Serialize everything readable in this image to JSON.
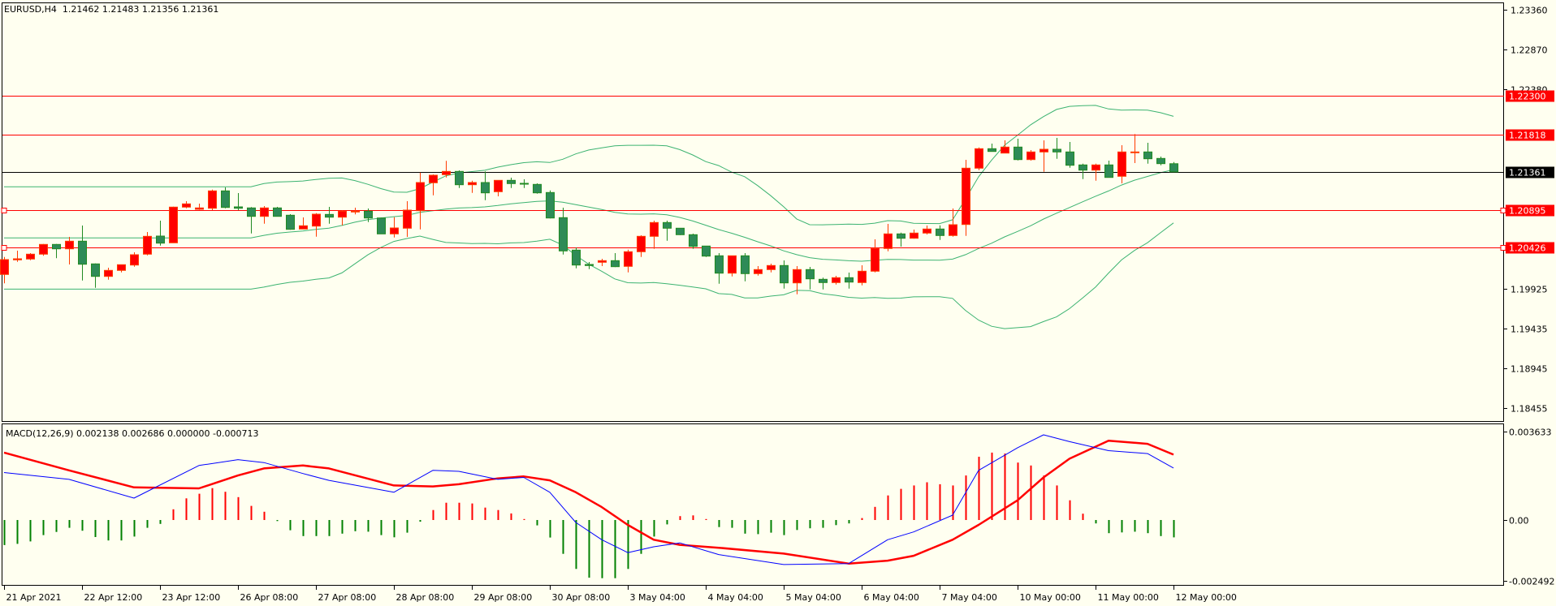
{
  "header": {
    "symbol_tf": "EURUSD,H4",
    "ohlc": "1.21462 1.21483 1.21356 1.21361"
  },
  "macd_header": "MACD(12,26,9) 0.002138 0.002686 0.000000 -0.000713",
  "colors": {
    "background": "#fffff0",
    "bull_body": "#ff0000",
    "bull_border": "#ff3c00",
    "bear_body": "#2e8b57",
    "bear_border": "#228b22",
    "bands": "#3cb371",
    "macd_main": "#0000ff",
    "macd_signal": "#ff0000",
    "hist_pos": "#ff0000",
    "hist_neg": "#008000",
    "hline": "#ff0000",
    "bid_line": "#000000"
  },
  "chart_data": [
    {
      "type": "candlestick",
      "title": "EURUSD,H4",
      "ylim": [
        1.1828,
        1.2345
      ],
      "candles": [
        [
          1.20097,
          1.20313,
          1.19987,
          1.2028
        ],
        [
          1.20277,
          1.2039,
          1.20253,
          1.2029
        ],
        [
          1.20287,
          1.2036,
          1.20273,
          1.20347
        ],
        [
          1.20347,
          1.20473,
          1.20327,
          1.20467
        ],
        [
          1.20467,
          1.20473,
          1.20297,
          1.20413
        ],
        [
          1.20413,
          1.2056,
          1.2022,
          1.20507
        ],
        [
          1.20507,
          1.207,
          1.20023,
          1.20223
        ],
        [
          1.20227,
          1.20233,
          1.19933,
          1.20073
        ],
        [
          1.20073,
          1.2018,
          1.20033,
          1.20147
        ],
        [
          1.20147,
          1.2022,
          1.20123,
          1.20217
        ],
        [
          1.20213,
          1.2037,
          1.20193,
          1.2034
        ],
        [
          1.20347,
          1.2062,
          1.20333,
          1.20567
        ],
        [
          1.2057,
          1.2076,
          1.20453,
          1.20483
        ],
        [
          1.20487,
          1.20933,
          1.20487,
          1.20927
        ],
        [
          1.20927,
          1.21,
          1.20913,
          1.20967
        ],
        [
          1.209,
          1.2097,
          1.20893,
          1.20917
        ],
        [
          1.20913,
          1.21143,
          1.20887,
          1.21127
        ],
        [
          1.21127,
          1.2117,
          1.20913,
          1.20923
        ],
        [
          1.2093,
          1.211,
          1.20887,
          1.20913
        ],
        [
          1.20917,
          1.20927,
          1.20603,
          1.20813
        ],
        [
          1.20813,
          1.2094,
          1.20723,
          1.20917
        ],
        [
          1.20917,
          1.2093,
          1.20813,
          1.20813
        ],
        [
          1.20827,
          1.2084,
          1.20647,
          1.20653
        ],
        [
          1.20657,
          1.208,
          1.20657,
          1.20697
        ],
        [
          1.20693,
          1.20853,
          1.20563,
          1.2084
        ],
        [
          1.20837,
          1.2093,
          1.20723,
          1.20803
        ],
        [
          1.20803,
          1.20887,
          1.20703,
          1.20877
        ],
        [
          1.20873,
          1.2092,
          1.20837,
          1.20877
        ],
        [
          1.20877,
          1.2091,
          1.20743,
          1.20793
        ],
        [
          1.20793,
          1.20797,
          1.20597,
          1.20597
        ],
        [
          1.20597,
          1.20803,
          1.20553,
          1.2067
        ],
        [
          1.20667,
          1.21,
          1.2056,
          1.2089
        ],
        [
          1.20883,
          1.21353,
          1.20653,
          1.2123
        ],
        [
          1.21227,
          1.2133,
          1.21073,
          1.2132
        ],
        [
          1.21327,
          1.21497,
          1.21293,
          1.21367
        ],
        [
          1.21367,
          1.2138,
          1.21163,
          1.21203
        ],
        [
          1.21203,
          1.21253,
          1.21103,
          1.2123
        ],
        [
          1.2123,
          1.21367,
          1.21013,
          1.21103
        ],
        [
          1.21117,
          1.2126,
          1.2106,
          1.21257
        ],
        [
          1.21257,
          1.2129,
          1.21163,
          1.21217
        ],
        [
          1.2122,
          1.2127,
          1.21163,
          1.2121
        ],
        [
          1.21207,
          1.2122,
          1.21093,
          1.21103
        ],
        [
          1.21107,
          1.21133,
          1.20787,
          1.20793
        ],
        [
          1.20797,
          1.2092,
          1.20343,
          1.20387
        ],
        [
          1.20397,
          1.2043,
          1.20173,
          1.20213
        ],
        [
          1.2022,
          1.2025,
          1.20163,
          1.20207
        ],
        [
          1.20247,
          1.2029,
          1.202,
          1.20267
        ],
        [
          1.20267,
          1.2036,
          1.20187,
          1.20193
        ],
        [
          1.20197,
          1.20403,
          1.20123,
          1.20377
        ],
        [
          1.20377,
          1.2058,
          1.20313,
          1.20567
        ],
        [
          1.20567,
          1.2076,
          1.20413,
          1.20737
        ],
        [
          1.20737,
          1.2076,
          1.20513,
          1.20667
        ],
        [
          1.20667,
          1.2067,
          1.20583,
          1.20587
        ],
        [
          1.20587,
          1.206,
          1.20413,
          1.20443
        ],
        [
          1.20447,
          1.2045,
          1.20313,
          1.20323
        ],
        [
          1.20327,
          1.2036,
          1.19983,
          1.20113
        ],
        [
          1.20113,
          1.2033,
          1.20073,
          1.20327
        ],
        [
          1.20327,
          1.2036,
          1.20013,
          1.20107
        ],
        [
          1.20107,
          1.202,
          1.20083,
          1.20157
        ],
        [
          1.20157,
          1.2023,
          1.20123,
          1.20207
        ],
        [
          1.20207,
          1.2027,
          1.19923,
          1.19993
        ],
        [
          1.19993,
          1.202,
          1.19853,
          1.20157
        ],
        [
          1.20157,
          1.2019,
          1.19913,
          1.20043
        ],
        [
          1.20037,
          1.20057,
          1.19913,
          1.19997
        ],
        [
          1.19997,
          1.2008,
          1.19973,
          1.20057
        ],
        [
          1.20057,
          1.2012,
          1.19923,
          1.20003
        ],
        [
          1.19997,
          1.2021,
          1.19963,
          1.20137
        ],
        [
          1.20137,
          1.2053,
          1.20123,
          1.20417
        ],
        [
          1.20417,
          1.2072,
          1.20383,
          1.20597
        ],
        [
          1.20597,
          1.20613,
          1.2044,
          1.20543
        ],
        [
          1.20543,
          1.2065,
          1.20537,
          1.20607
        ],
        [
          1.20607,
          1.207,
          1.2059,
          1.20657
        ],
        [
          1.20657,
          1.20703,
          1.20523,
          1.20577
        ],
        [
          1.20577,
          1.2091,
          1.20563,
          1.2071
        ],
        [
          1.20713,
          1.2151,
          1.20573,
          1.21407
        ],
        [
          1.21407,
          1.21663,
          1.21383,
          1.21647
        ],
        [
          1.21647,
          1.2171,
          1.21613,
          1.21613
        ],
        [
          1.21593,
          1.2175,
          1.21593,
          1.21667
        ],
        [
          1.21667,
          1.2177,
          1.21503,
          1.21513
        ],
        [
          1.21513,
          1.2163,
          1.215,
          1.21607
        ],
        [
          1.21607,
          1.2175,
          1.21363,
          1.2164
        ],
        [
          1.2164,
          1.2178,
          1.21523,
          1.21607
        ],
        [
          1.21607,
          1.2173,
          1.21413,
          1.21443
        ],
        [
          1.21447,
          1.21463,
          1.21273,
          1.21383
        ],
        [
          1.21383,
          1.21463,
          1.21253,
          1.21447
        ],
        [
          1.21447,
          1.215,
          1.21293,
          1.21293
        ],
        [
          1.21307,
          1.2169,
          1.2122,
          1.21607
        ],
        [
          1.21603,
          1.21827,
          1.2147,
          1.21607
        ],
        [
          1.21607,
          1.2172,
          1.21463,
          1.21523
        ],
        [
          1.21527,
          1.2155,
          1.21443,
          1.21463
        ],
        [
          1.21462,
          1.21483,
          1.21356,
          1.21361
        ]
      ],
      "y_ticks": [
        "1.23360",
        "1.22870",
        "1.22380",
        "1.19925",
        "1.19435",
        "1.18945",
        "1.18455"
      ],
      "hlines": [
        {
          "price": 1.223,
          "label": "1.22300",
          "kind": "level"
        },
        {
          "price": 1.21818,
          "label": "1.21818",
          "kind": "level"
        },
        {
          "price": 1.21361,
          "label": "1.21361",
          "kind": "bid"
        },
        {
          "price": 1.20895,
          "label": "1.20895",
          "kind": "level",
          "markers": true
        },
        {
          "price": 1.20426,
          "label": "1.20426",
          "kind": "level",
          "markers": true
        }
      ],
      "x_labels": [
        {
          "bar": 0,
          "label": "21 Apr 2021"
        },
        {
          "bar": 6,
          "label": "22 Apr 12:00"
        },
        {
          "bar": 12,
          "label": "23 Apr 12:00"
        },
        {
          "bar": 18,
          "label": "26 Apr 08:00"
        },
        {
          "bar": 24,
          "label": "27 Apr 08:00"
        },
        {
          "bar": 30,
          "label": "28 Apr 08:00"
        },
        {
          "bar": 36,
          "label": "29 Apr 08:00"
        },
        {
          "bar": 42,
          "label": "30 Apr 08:00"
        },
        {
          "bar": 48,
          "label": "3 May 04:00"
        },
        {
          "bar": 54,
          "label": "4 May 04:00"
        },
        {
          "bar": 60,
          "label": "5 May 04:00"
        },
        {
          "bar": 66,
          "label": "6 May 04:00"
        },
        {
          "bar": 72,
          "label": "7 May 04:00"
        },
        {
          "bar": 78,
          "label": "10 May 00:00"
        },
        {
          "bar": 84,
          "label": "11 May 00:00"
        },
        {
          "bar": 90,
          "label": "12 May 00:00"
        }
      ]
    },
    {
      "type": "line",
      "title": "MACD(12,26,9)",
      "ylim": [
        -0.0027,
        0.003967
      ],
      "y_ticks": [
        {
          "value": 0.003633,
          "label": "0.003633"
        },
        {
          "value": 0,
          "label": "0.00"
        },
        {
          "value": -0.002492,
          "label": "-0.002492"
        }
      ],
      "main": [
        [
          0,
          0.00195
        ],
        [
          5,
          0.00167
        ],
        [
          10,
          0.0009
        ],
        [
          15,
          0.00224
        ],
        [
          18,
          0.00248
        ],
        [
          20,
          0.00236
        ],
        [
          23,
          0.00191
        ],
        [
          25,
          0.00163
        ],
        [
          30,
          0.00114
        ],
        [
          33,
          0.00204
        ],
        [
          35,
          0.002
        ],
        [
          38,
          0.00167
        ],
        [
          40,
          0.00175
        ],
        [
          42,
          0.00114
        ],
        [
          44,
          -0.0001
        ],
        [
          46,
          -0.00081
        ],
        [
          48,
          -0.00134
        ],
        [
          50,
          -0.0011
        ],
        [
          52,
          -0.00094
        ],
        [
          55,
          -0.00142
        ],
        [
          60,
          -0.00183
        ],
        [
          65,
          -0.00179
        ],
        [
          68,
          -0.00081
        ],
        [
          70,
          -0.00049
        ],
        [
          73,
          0.0002
        ],
        [
          75,
          0.00204
        ],
        [
          78,
          0.00297
        ],
        [
          80,
          0.0035
        ],
        [
          82,
          0.00322
        ],
        [
          85,
          0.00285
        ],
        [
          88,
          0.00273
        ],
        [
          90,
          0.002138
        ]
      ],
      "signal": [
        [
          0,
          0.00277
        ],
        [
          5,
          0.00204
        ],
        [
          10,
          0.00134
        ],
        [
          15,
          0.0013
        ],
        [
          18,
          0.00183
        ],
        [
          20,
          0.00212
        ],
        [
          23,
          0.00224
        ],
        [
          25,
          0.00212
        ],
        [
          30,
          0.00142
        ],
        [
          33,
          0.00138
        ],
        [
          35,
          0.00147
        ],
        [
          38,
          0.00171
        ],
        [
          40,
          0.00179
        ],
        [
          42,
          0.00163
        ],
        [
          44,
          0.00114
        ],
        [
          46,
          0.00053
        ],
        [
          48,
          -0.0002
        ],
        [
          50,
          -0.00081
        ],
        [
          52,
          -0.00102
        ],
        [
          55,
          -0.00114
        ],
        [
          60,
          -0.00138
        ],
        [
          65,
          -0.00179
        ],
        [
          68,
          -0.00167
        ],
        [
          70,
          -0.00147
        ],
        [
          73,
          -0.00081
        ],
        [
          75,
          -0.0002
        ],
        [
          78,
          0.00081
        ],
        [
          80,
          0.00175
        ],
        [
          82,
          0.00252
        ],
        [
          85,
          0.00326
        ],
        [
          88,
          0.00313
        ],
        [
          90,
          0.002686
        ]
      ],
      "histogram": [
        -0.00103,
        -0.00098,
        -0.00088,
        -0.00062,
        -0.00049,
        -0.00032,
        -0.00044,
        -0.0007,
        -0.00084,
        -0.00084,
        -0.00068,
        -0.00032,
        -0.00016,
        0.00044,
        0.00089,
        0.00108,
        0.00131,
        0.00116,
        0.00094,
        0.00058,
        0.00034,
        -1e-05,
        -0.00042,
        -0.00066,
        -0.00066,
        -0.00066,
        -0.00056,
        -0.00046,
        -0.00048,
        -0.00062,
        -0.00071,
        -0.00052,
        -7e-05,
        0.00041,
        0.00071,
        0.00071,
        0.00068,
        0.00051,
        0.00041,
        0.00027,
        4e-05,
        -0.00022,
        -0.00072,
        -0.00139,
        -0.00201,
        -0.00237,
        -0.00239,
        -0.00239,
        -0.00201,
        -0.00139,
        -0.00068,
        -0.00018,
        0.00016,
        0.00019,
        4e-05,
        -0.00029,
        -0.00032,
        -0.00056,
        -0.00058,
        -0.00052,
        -0.00062,
        -0.00041,
        -0.00034,
        -0.00032,
        -0.00021,
        -0.00014,
        8e-05,
        0.00054,
        0.00101,
        0.00128,
        0.00142,
        0.00155,
        0.00147,
        0.00142,
        0.00183,
        0.0026,
        0.00277,
        0.00273,
        0.00236,
        0.00224,
        0.00183,
        0.00142,
        0.00081,
        0.00026,
        -0.00014,
        -0.00054,
        -0.00051,
        -0.00048,
        -0.00054,
        -0.00066,
        -0.000713
      ]
    }
  ]
}
